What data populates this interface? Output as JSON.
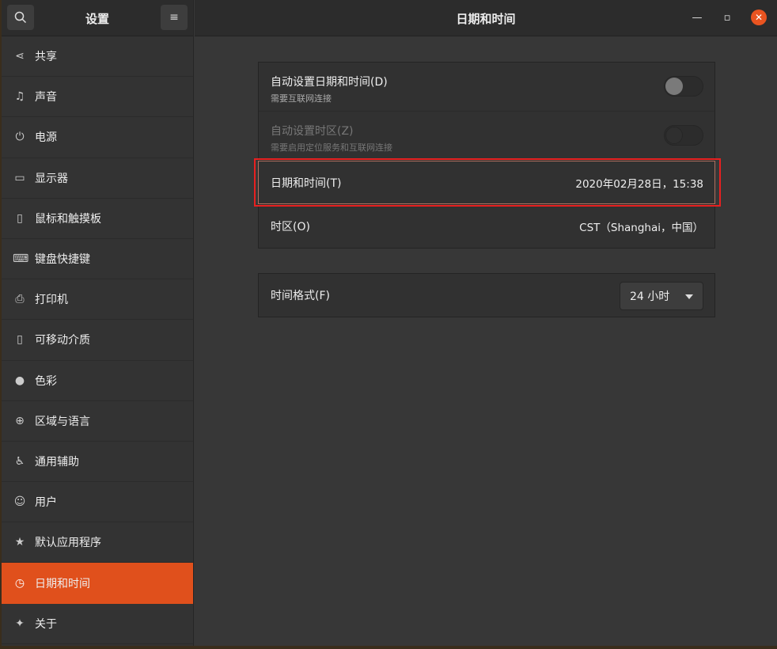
{
  "sidebar": {
    "title": "设置",
    "items": [
      {
        "label": "共享",
        "icon": "share-icon"
      },
      {
        "label": "声音",
        "icon": "music-note-icon"
      },
      {
        "label": "电源",
        "icon": "power-icon"
      },
      {
        "label": "显示器",
        "icon": "display-icon"
      },
      {
        "label": "鼠标和触摸板",
        "icon": "mouse-icon"
      },
      {
        "label": "键盘快捷键",
        "icon": "keyboard-icon"
      },
      {
        "label": "打印机",
        "icon": "printer-icon"
      },
      {
        "label": "可移动介质",
        "icon": "usb-drive-icon"
      },
      {
        "label": "色彩",
        "icon": "color-icon"
      },
      {
        "label": "区域与语言",
        "icon": "globe-icon"
      },
      {
        "label": "通用辅助",
        "icon": "accessibility-icon"
      },
      {
        "label": "用户",
        "icon": "user-icon"
      },
      {
        "label": "默认应用程序",
        "icon": "star-icon"
      },
      {
        "label": "日期和时间",
        "icon": "clock-icon",
        "selected": true
      },
      {
        "label": "关于",
        "icon": "sparkle-icon"
      }
    ]
  },
  "header": {
    "title": "日期和时间"
  },
  "settings": {
    "auto_datetime": {
      "label": "自动设置日期和时间(D)",
      "sub": "需要互联网连接",
      "on": false
    },
    "auto_timezone": {
      "label": "自动设置时区(Z)",
      "sub": "需要启用定位服务和互联网连接",
      "on": false
    },
    "datetime": {
      "label": "日期和时间(T)",
      "value": "2020年02月28日，15:38"
    },
    "timezone": {
      "label": "时区(O)",
      "value": "CST（Shanghai，中国）"
    },
    "time_format": {
      "label": "时间格式(F)",
      "value": "24 小时"
    }
  },
  "colors": {
    "accent": "#e0501c",
    "highlight": "#e82020"
  }
}
